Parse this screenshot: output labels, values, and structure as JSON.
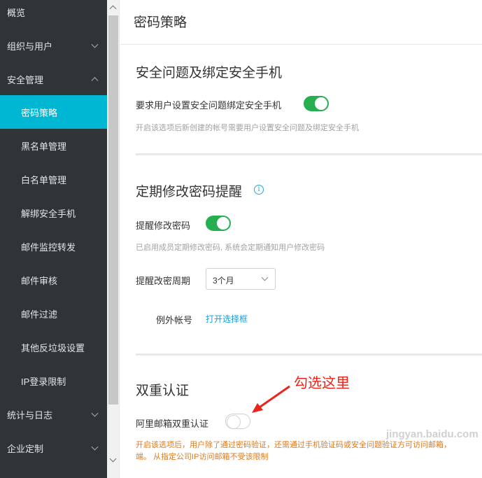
{
  "sidebar": {
    "items": [
      {
        "label": "概览",
        "level": "top",
        "chevron": ""
      },
      {
        "label": "组织与用户",
        "level": "top",
        "chevron": "down"
      },
      {
        "label": "安全管理",
        "level": "top",
        "chevron": "up"
      },
      {
        "label": "密码策略",
        "level": "sub",
        "active": true
      },
      {
        "label": "黑名单管理",
        "level": "sub"
      },
      {
        "label": "白名单管理",
        "level": "sub"
      },
      {
        "label": "解绑安全手机",
        "level": "sub"
      },
      {
        "label": "邮件监控转发",
        "level": "sub"
      },
      {
        "label": "邮件审核",
        "level": "sub"
      },
      {
        "label": "邮件过滤",
        "level": "sub"
      },
      {
        "label": "其他反垃圾设置",
        "level": "sub"
      },
      {
        "label": "IP登录限制",
        "level": "sub"
      },
      {
        "label": "统计与日志",
        "level": "top",
        "chevron": "down"
      },
      {
        "label": "企业定制",
        "level": "top",
        "chevron": "down"
      }
    ]
  },
  "header": {
    "title": "密码策略"
  },
  "security_question": {
    "title": "安全问题及绑定安全手机",
    "toggle_label": "要求用户设置安全问题绑定安全手机",
    "toggle_on": true,
    "hint": "开启该选项后新创建的帐号需要用户设置安全问题及绑定安全手机"
  },
  "password_reminder": {
    "title": "定期修改密码提醒",
    "info_icon": "info-icon",
    "toggle_label": "提醒修改密码",
    "toggle_on": true,
    "hint": "已启用成员定期修改密码, 系统会定期通知用户修改密码",
    "period_label": "提醒改密周期",
    "period_value": "3个月",
    "exception_label": "例外帐号",
    "exception_link": "打开选择框"
  },
  "two_factor": {
    "title": "双重认证",
    "toggle_label": "阿里邮箱双重认证",
    "toggle_on": false,
    "warning_line1": "开启该选项后，用户除了通过密码验证，还需通过手机验证码或安全问题验证方可访问邮箱，",
    "warning_line2": "端。 从指定公司IP访问邮箱不受该限制"
  },
  "annotation": {
    "text": "勾选这里",
    "color": "#e8261c"
  },
  "watermark": "jingyan.baidu.com",
  "colors": {
    "sidebar_bg": "#2f3437",
    "active": "#00b7d3",
    "toggle_on": "#27ae50",
    "link": "#1e9bd7",
    "warning": "#e07a1e"
  }
}
